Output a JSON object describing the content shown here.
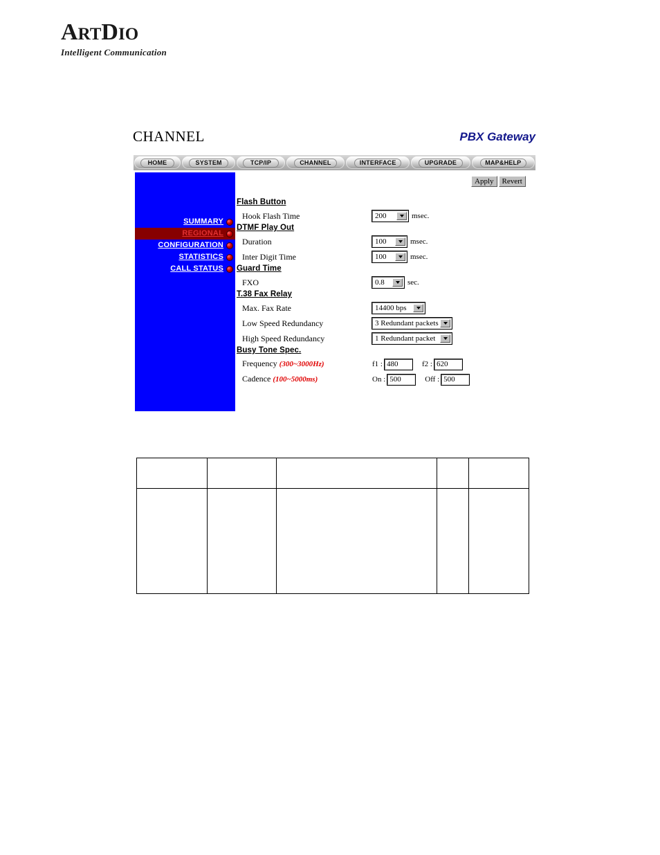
{
  "logo": {
    "word_part1": "A",
    "word_part2": "RT",
    "word_part3": "D",
    "word_part4": "IO",
    "tagline": "Intelligent Communication"
  },
  "header": {
    "page_title": "CHANNEL",
    "product_title": "PBX Gateway"
  },
  "nav": {
    "items": [
      {
        "label": "HOME"
      },
      {
        "label": "SYSTEM"
      },
      {
        "label": "TCP/IP"
      },
      {
        "label": "CHANNEL"
      },
      {
        "label": "INTERFACE"
      },
      {
        "label": "UPGRADE"
      },
      {
        "label": "MAP&HELP"
      }
    ]
  },
  "sidebar": {
    "background_color": "#0000FF",
    "active_background_color": "#870000",
    "items": [
      {
        "label": "SUMMARY",
        "active": false
      },
      {
        "label": "REGIONAL",
        "active": true
      },
      {
        "label": "CONFIGURATION",
        "active": false
      },
      {
        "label": "STATISTICS",
        "active": false
      },
      {
        "label": "CALL STATUS",
        "active": false
      }
    ]
  },
  "actions": {
    "apply_label": "Apply",
    "revert_label": "Revert"
  },
  "form": {
    "sections": [
      {
        "heading": "Flash Button",
        "rows": [
          {
            "label": "Hook Flash Time",
            "control": "select",
            "value": "200",
            "unit": "msec."
          }
        ]
      },
      {
        "heading": "DTMF Play Out",
        "rows": [
          {
            "label": "Duration",
            "control": "select",
            "value": "100",
            "unit": "msec."
          },
          {
            "label": "Inter Digit Time",
            "control": "select",
            "value": "100",
            "unit": "msec."
          }
        ]
      },
      {
        "heading": "Guard Time",
        "rows": [
          {
            "label": "FXO",
            "control": "select",
            "value": "0.8",
            "unit": "sec."
          }
        ]
      },
      {
        "heading": "T.38 Fax Relay",
        "rows": [
          {
            "label": "Max. Fax Rate",
            "control": "select",
            "value": "14400 bps",
            "unit": ""
          },
          {
            "label": "Low Speed Redundancy",
            "control": "select",
            "value": "3 Redundant packets",
            "unit": ""
          },
          {
            "label": "High Speed Redundancy",
            "control": "select",
            "value": "1 Redundant packet",
            "unit": ""
          }
        ]
      },
      {
        "heading": "Busy Tone Spec.",
        "rows": [
          {
            "label": "Frequency ",
            "hint": "(300~3000Hz)",
            "control": "pair",
            "field1_label": "f1 :",
            "field1_value": "480",
            "field2_label": "f2 :",
            "field2_value": "620"
          },
          {
            "label": "Cadence ",
            "hint": "(100~5000ms)",
            "control": "pair",
            "field1_label": "On :",
            "field1_value": "500",
            "field2_label": "Off :",
            "field2_value": "500"
          }
        ]
      }
    ]
  },
  "bottom_table": {
    "columns": 5,
    "header_row": [
      "",
      "",
      "",
      "",
      ""
    ],
    "body_row": [
      "",
      "",
      "",
      "",
      ""
    ]
  }
}
